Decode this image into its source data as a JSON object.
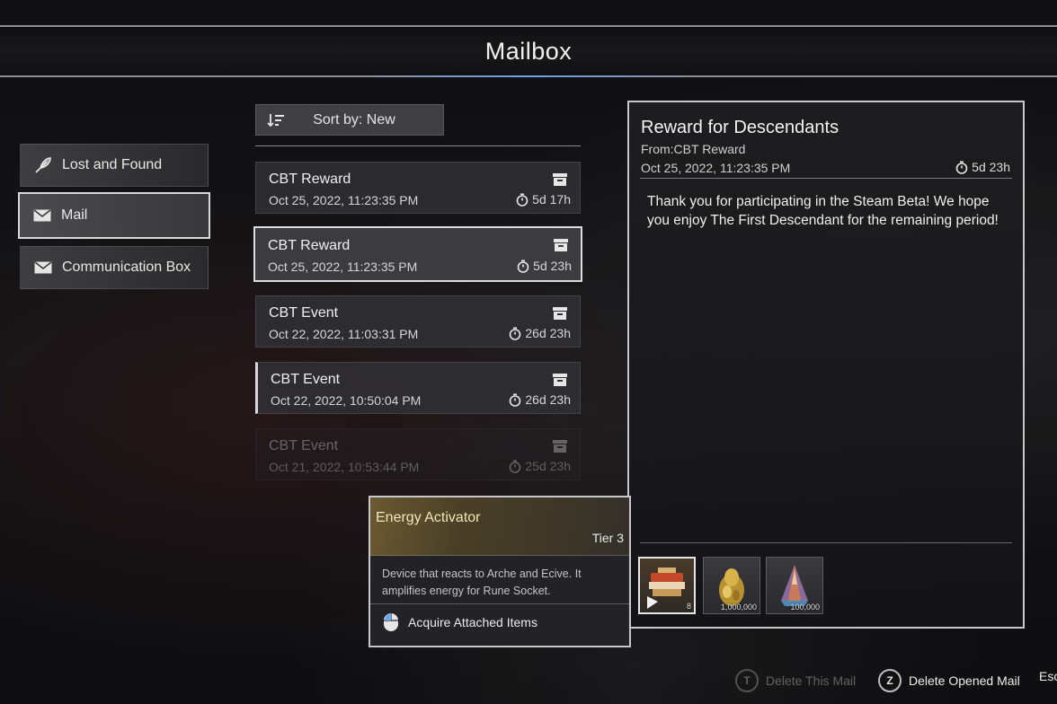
{
  "header": {
    "title": "Mailbox"
  },
  "nav": {
    "items": [
      {
        "label": "Lost and Found",
        "icon": "feather-icon"
      },
      {
        "label": "Mail",
        "icon": "envelope-icon",
        "active": true
      },
      {
        "label": "Communication Box",
        "icon": "envelope-icon"
      }
    ]
  },
  "sort": {
    "label": "Sort by: New",
    "icon": "sort-icon"
  },
  "mails": [
    {
      "sender": "CBT Reward",
      "date": "Oct 25, 2022, 11:23:35 PM",
      "remaining": "5d 17h"
    },
    {
      "sender": "CBT Reward",
      "date": "Oct 25, 2022, 11:23:35 PM",
      "remaining": "5d 23h",
      "selected": true
    },
    {
      "sender": "CBT Event",
      "date": "Oct 22, 2022, 11:03:31 PM",
      "remaining": "26d 23h"
    },
    {
      "sender": "CBT Event",
      "date": "Oct 22, 2022, 10:50:04 PM",
      "remaining": "26d 23h"
    },
    {
      "sender": "CBT Event",
      "date": "Oct 21, 2022, 10:53:44 PM",
      "remaining": "25d 23h"
    }
  ],
  "detail": {
    "title": "Reward for Descendants",
    "from": "From:CBT Reward",
    "date": "Oct 25, 2022, 11:23:35 PM",
    "remaining": "5d 23h",
    "body": "Thank you for participating in the Steam Beta! We hope you enjoy The First Descendant for the remaining period!",
    "attachments": [
      {
        "name": "Energy Activator",
        "qty": "8"
      },
      {
        "name": "gold-item",
        "qty": "1,000,000"
      },
      {
        "name": "crystal-item",
        "qty": "100,000"
      }
    ]
  },
  "tooltip": {
    "name": "Energy Activator",
    "tier": "Tier 3",
    "description": "Device that reacts to Arche and Ecive. It amplifies energy for Rune Socket.",
    "action_label": "Acquire Attached Items"
  },
  "hints": [
    {
      "key": "T",
      "label": "Delete This Mail",
      "disabled": true
    },
    {
      "key": "Z",
      "label": "Delete Opened Mail",
      "disabled": false
    },
    {
      "key": "Esc",
      "label": "",
      "disabled": false
    }
  ],
  "colors": {
    "accent_blue": "#6e9fe8",
    "tooltip_gold": "#6b5a32"
  }
}
